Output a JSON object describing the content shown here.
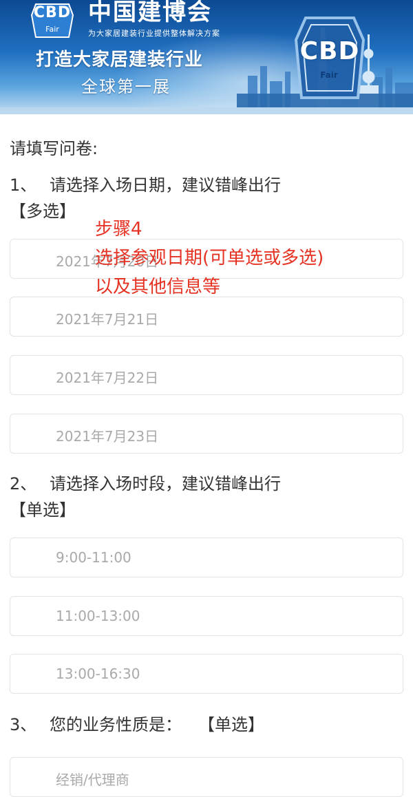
{
  "banner": {
    "logo_text": "CBD",
    "logo_subtext": "Fair",
    "brand_title": "中国建博会",
    "brand_subtitle": "为大家居建装行业提供整体解决方案",
    "slogan_line1": "打造大家居建装行业",
    "slogan_line2": "全球第一展",
    "big_logo_text": "CBD",
    "big_logo_subtext": "Fair",
    "colors": {
      "sky_top": "#0d4a93",
      "sky_bottom": "#c4def2"
    }
  },
  "form": {
    "intro": "请填写问卷:",
    "questions": [
      {
        "number": "1、",
        "title": "请选择入场日期，建议错峰出行",
        "type": "【多选】",
        "options": [
          "2021年7月20日",
          "2021年7月21日",
          "2021年7月22日",
          "2021年7月23日"
        ]
      },
      {
        "number": "2、",
        "title": "请选择入场时段，建议错峰出行",
        "type": "【单选】",
        "options": [
          "9:00-11:00",
          "11:00-13:00",
          "13:00-16:30"
        ]
      },
      {
        "number": "3、",
        "title": "您的业务性质是：",
        "type": "【单选】",
        "options": [
          "经销/代理商"
        ]
      }
    ]
  },
  "annotation": {
    "lines": [
      "步骤4",
      "选择参观日期(可单选或多选)",
      "以及其他信息等"
    ],
    "color": "#e53222"
  }
}
